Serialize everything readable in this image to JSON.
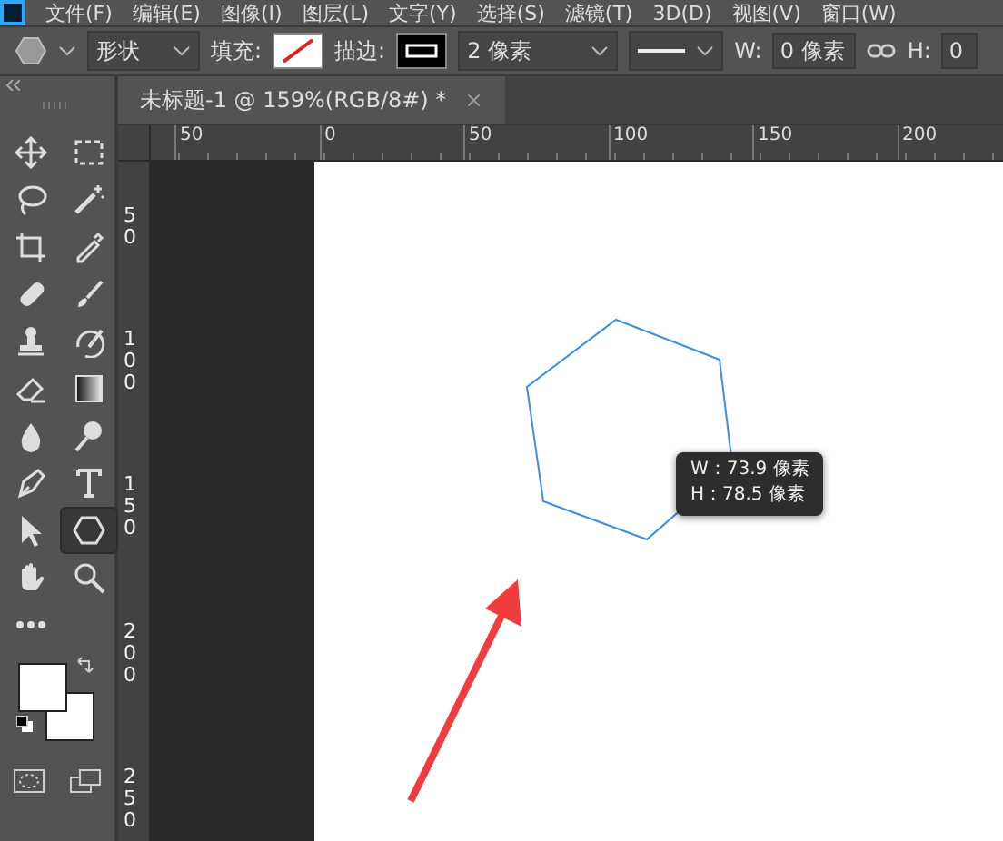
{
  "menu_bar": [
    "文件(F)",
    "编辑(E)",
    "图像(I)",
    "图层(L)",
    "文字(Y)",
    "选择(S)",
    "滤镜(T)",
    "3D(D)",
    "视图(V)",
    "窗口(W)"
  ],
  "options_bar": {
    "mode": "形状",
    "fill_label": "填充:",
    "stroke_label": "描边:",
    "stroke_width": "2 像素",
    "width_label": "W:",
    "width_value": "0 像素",
    "height_label": "H:",
    "height_value": "0"
  },
  "document_tab": {
    "title": "未标题-1 @ 159%(RGB/8#) *",
    "close": "×"
  },
  "rulers": {
    "horizontal": [
      "50",
      "0",
      "50",
      "100",
      "150",
      "200"
    ],
    "vertical": [
      "50",
      "100",
      "150",
      "200",
      "250"
    ]
  },
  "tools": [
    {
      "kind": "move",
      "selected": false
    },
    {
      "kind": "marquee",
      "selected": false
    },
    {
      "kind": "lasso",
      "selected": false
    },
    {
      "kind": "wand",
      "selected": false
    },
    {
      "kind": "crop",
      "selected": false
    },
    {
      "kind": "eyedropper",
      "selected": false
    },
    {
      "kind": "bandage",
      "selected": false
    },
    {
      "kind": "brush",
      "selected": false
    },
    {
      "kind": "stamp",
      "selected": false
    },
    {
      "kind": "history",
      "selected": false
    },
    {
      "kind": "eraser",
      "selected": false
    },
    {
      "kind": "gradient",
      "selected": false
    },
    {
      "kind": "drop",
      "selected": false
    },
    {
      "kind": "dodge",
      "selected": false
    },
    {
      "kind": "pen",
      "selected": false
    },
    {
      "kind": "type",
      "selected": false
    },
    {
      "kind": "pointer",
      "selected": false
    },
    {
      "kind": "hexagon",
      "selected": true
    },
    {
      "kind": "hand",
      "selected": false
    },
    {
      "kind": "zoom",
      "selected": false
    },
    {
      "kind": "more",
      "selected": false
    }
  ],
  "tooltip": [
    "W：73.9 像素",
    "H：78.5 像素"
  ]
}
